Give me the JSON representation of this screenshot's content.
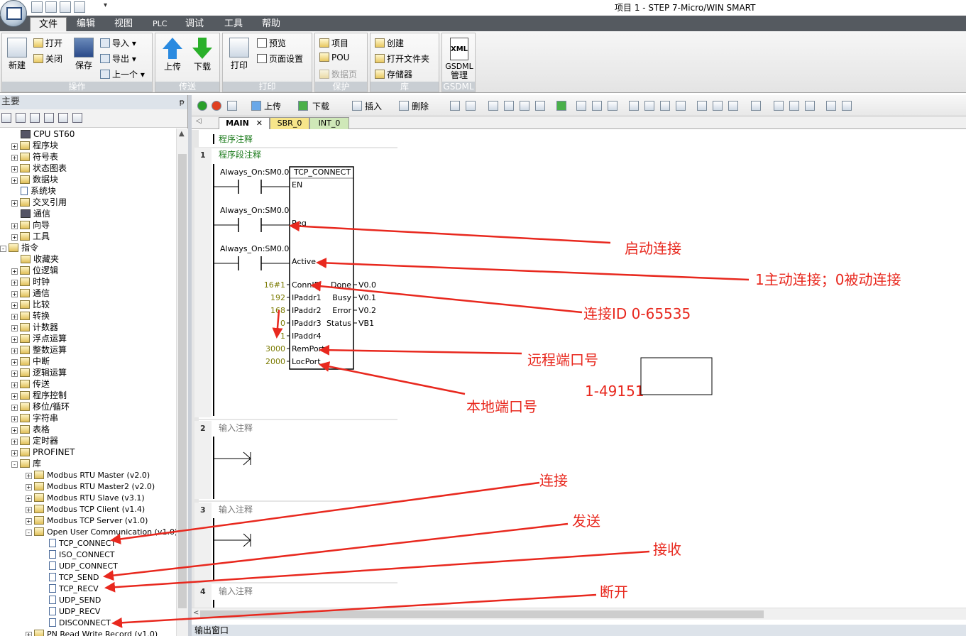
{
  "window": {
    "title": "项目 1 - STEP 7-Micro/WIN SMART"
  },
  "menu": {
    "tabs": [
      "文件",
      "编辑",
      "视图",
      "PLC",
      "调试",
      "工具",
      "帮助"
    ]
  },
  "ribbon": {
    "groups": {
      "operate": {
        "label": "操作",
        "new": "新建",
        "open": "打开",
        "close": "关闭",
        "save": "保存",
        "import": "导入",
        "export": "导出",
        "recent": "上一个"
      },
      "transfer": {
        "label": "传送",
        "upload": "上传",
        "download": "下载"
      },
      "print": {
        "label": "打印",
        "print": "打印",
        "preview": "预览",
        "page_setup": "页面设置"
      },
      "protect": {
        "label": "保护",
        "project": "项目",
        "pou": "POU",
        "datablock": "数据页"
      },
      "library": {
        "label": "库",
        "create": "创建",
        "open_folder": "打开文件夹",
        "memory": "存储器"
      },
      "gsdml": {
        "label": "GSDML",
        "manage": "管理",
        "icon_text": "XML"
      }
    }
  },
  "left_pane": {
    "title": "主要",
    "pin": "ᵽ",
    "tree": [
      {
        "label": "CPU ST60",
        "indent": 1,
        "exp": "",
        "icon": "cpu"
      },
      {
        "label": "程序块",
        "indent": 1,
        "exp": "+",
        "icon": "folder"
      },
      {
        "label": "符号表",
        "indent": 1,
        "exp": "+",
        "icon": "folder"
      },
      {
        "label": "状态图表",
        "indent": 1,
        "exp": "+",
        "icon": "folder"
      },
      {
        "label": "数据块",
        "indent": 1,
        "exp": "+",
        "icon": "folder"
      },
      {
        "label": "系统块",
        "indent": 1,
        "exp": "",
        "icon": "doc"
      },
      {
        "label": "交叉引用",
        "indent": 1,
        "exp": "+",
        "icon": "folder"
      },
      {
        "label": "通信",
        "indent": 1,
        "exp": "",
        "icon": "pc"
      },
      {
        "label": "向导",
        "indent": 1,
        "exp": "+",
        "icon": "folder"
      },
      {
        "label": "工具",
        "indent": 1,
        "exp": "+",
        "icon": "folder"
      },
      {
        "label": "指令",
        "indent": 0,
        "exp": "-",
        "icon": "folder"
      },
      {
        "label": "收藏夹",
        "indent": 1,
        "exp": "",
        "icon": "folder"
      },
      {
        "label": "位逻辑",
        "indent": 1,
        "exp": "+",
        "icon": "folder"
      },
      {
        "label": "时钟",
        "indent": 1,
        "exp": "+",
        "icon": "folder"
      },
      {
        "label": "通信",
        "indent": 1,
        "exp": "+",
        "icon": "folder"
      },
      {
        "label": "比较",
        "indent": 1,
        "exp": "+",
        "icon": "folder"
      },
      {
        "label": "转换",
        "indent": 1,
        "exp": "+",
        "icon": "folder"
      },
      {
        "label": "计数器",
        "indent": 1,
        "exp": "+",
        "icon": "folder"
      },
      {
        "label": "浮点运算",
        "indent": 1,
        "exp": "+",
        "icon": "folder"
      },
      {
        "label": "整数运算",
        "indent": 1,
        "exp": "+",
        "icon": "folder"
      },
      {
        "label": "中断",
        "indent": 1,
        "exp": "+",
        "icon": "folder"
      },
      {
        "label": "逻辑运算",
        "indent": 1,
        "exp": "+",
        "icon": "folder"
      },
      {
        "label": "传送",
        "indent": 1,
        "exp": "+",
        "icon": "folder"
      },
      {
        "label": "程序控制",
        "indent": 1,
        "exp": "+",
        "icon": "folder"
      },
      {
        "label": "移位/循环",
        "indent": 1,
        "exp": "+",
        "icon": "folder"
      },
      {
        "label": "字符串",
        "indent": 1,
        "exp": "+",
        "icon": "folder"
      },
      {
        "label": "表格",
        "indent": 1,
        "exp": "+",
        "icon": "folder"
      },
      {
        "label": "定时器",
        "indent": 1,
        "exp": "+",
        "icon": "folder"
      },
      {
        "label": "PROFINET",
        "indent": 1,
        "exp": "+",
        "icon": "folder"
      },
      {
        "label": "库",
        "indent": 1,
        "exp": "-",
        "icon": "folder"
      },
      {
        "label": "Modbus RTU Master (v2.0)",
        "indent": 2,
        "exp": "+",
        "icon": "folder"
      },
      {
        "label": "Modbus RTU Master2 (v2.0)",
        "indent": 2,
        "exp": "+",
        "icon": "folder"
      },
      {
        "label": "Modbus RTU Slave (v3.1)",
        "indent": 2,
        "exp": "+",
        "icon": "folder"
      },
      {
        "label": "Modbus TCP Client (v1.4)",
        "indent": 2,
        "exp": "+",
        "icon": "folder"
      },
      {
        "label": "Modbus TCP Server (v1.0)",
        "indent": 2,
        "exp": "+",
        "icon": "folder"
      },
      {
        "label": "Open User Communication (v1.0)",
        "indent": 2,
        "exp": "-",
        "icon": "folder"
      },
      {
        "label": "TCP_CONNECT",
        "indent": 3,
        "exp": "",
        "icon": "doc"
      },
      {
        "label": "ISO_CONNECT",
        "indent": 3,
        "exp": "",
        "icon": "doc"
      },
      {
        "label": "UDP_CONNECT",
        "indent": 3,
        "exp": "",
        "icon": "doc"
      },
      {
        "label": "TCP_SEND",
        "indent": 3,
        "exp": "",
        "icon": "doc"
      },
      {
        "label": "TCP_RECV",
        "indent": 3,
        "exp": "",
        "icon": "doc"
      },
      {
        "label": "UDP_SEND",
        "indent": 3,
        "exp": "",
        "icon": "doc"
      },
      {
        "label": "UDP_RECV",
        "indent": 3,
        "exp": "",
        "icon": "doc"
      },
      {
        "label": "DISCONNECT",
        "indent": 3,
        "exp": "",
        "icon": "doc"
      },
      {
        "label": "PN Read Write Record (v1.0)",
        "indent": 2,
        "exp": "+",
        "icon": "folder"
      }
    ]
  },
  "editor_toolbar": {
    "upload": "上传",
    "download": "下载",
    "insert": "插入",
    "delete": "删除"
  },
  "editor_tabs": [
    "MAIN",
    "SBR_0",
    "INT_0"
  ],
  "program": {
    "program_comment": "程序注释",
    "networks": [
      {
        "num": "1",
        "comment": "程序段注释"
      },
      {
        "num": "2",
        "comment": "输入注释"
      },
      {
        "num": "3",
        "comment": "输入注释"
      },
      {
        "num": "4",
        "comment": "输入注释"
      }
    ],
    "block": {
      "name": "TCP_CONNECT",
      "contacts": [
        "Always_On:SM0.0",
        "Always_On:SM0.0",
        "Always_On:SM0.0"
      ],
      "inputs": [
        {
          "pin": "EN",
          "value": ""
        },
        {
          "pin": "Req",
          "value": ""
        },
        {
          "pin": "Active",
          "value": ""
        },
        {
          "pin": "ConnID",
          "value": "16#1"
        },
        {
          "pin": "IPaddr1",
          "value": "192"
        },
        {
          "pin": "IPaddr2",
          "value": "168"
        },
        {
          "pin": "IPaddr3",
          "value": "0"
        },
        {
          "pin": "IPaddr4",
          "value": "1"
        },
        {
          "pin": "RemPort",
          "value": "3000"
        },
        {
          "pin": "LocPort",
          "value": "2000"
        }
      ],
      "outputs": [
        {
          "pin": "Done",
          "value": "V0.0"
        },
        {
          "pin": "Busy",
          "value": "V0.1"
        },
        {
          "pin": "Error",
          "value": "V0.2"
        },
        {
          "pin": "Status",
          "value": "VB1"
        }
      ]
    }
  },
  "annotations": {
    "start_connection": "启动连接",
    "active_mode": "1主动连接；0被动连接",
    "conn_id": "连接ID 0-65535",
    "remote_port": "远程端口号",
    "local_port": "本地端口号",
    "port_range": "1-49151",
    "connect": "连接",
    "send": "发送",
    "receive": "接收",
    "disconnect": "断开"
  },
  "output_window": {
    "title": "输出窗口"
  },
  "colors": {
    "annotation_red": "#e8281e",
    "value_olive": "#7a7a00",
    "comment_green": "#1a7a1a"
  }
}
